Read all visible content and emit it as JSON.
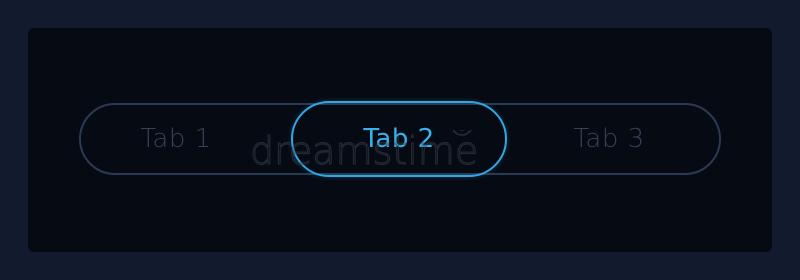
{
  "tabs": [
    {
      "label": "Tab 1",
      "selected": false
    },
    {
      "label": "Tab 2",
      "selected": true
    },
    {
      "label": "Tab 3",
      "selected": false
    }
  ],
  "colors": {
    "page_background": "#121a2d",
    "panel_background": "#060a12",
    "track_border": "#2a3a55",
    "inactive_text": "#33415b",
    "active_accent": "#2fa8e3",
    "active_text": "#35b3ee"
  },
  "watermark": {
    "text": "dreamstime",
    "icon": "spiral-logo-icon"
  }
}
